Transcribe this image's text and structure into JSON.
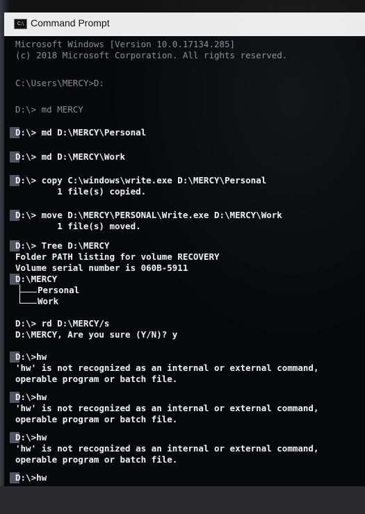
{
  "window": {
    "title": "Command Prompt",
    "icon": "C:\\",
    "background": "#070809",
    "text_color": "#f2f2f2"
  },
  "console": {
    "lines": [
      "Microsoft Windows [Version 10.0.17134.285]",
      "(c) 2018 Microsoft Corporation. All rights reserved.",
      "C:\\Users\\MERCY>D:",
      "D:\\> md MERCY",
      "D:\\> md D:\\MERCY\\Personal",
      "D:\\> md D:\\MERCY\\Work",
      "D:\\> copy C:\\windows\\write.exe D:\\MERCY\\Personal",
      "        1 file(s) copied.",
      "D:\\> move D:\\MERCY\\PERSONAL\\Write.exe D:\\MERCY\\Work",
      "        1 file(s) moved.",
      "D:\\> Tree D:\\MERCY",
      "Folder PATH listing for volume RECOVERY",
      "Volume serial number is 060B-5911",
      "D:\\MERCY",
      "Personal",
      "Work",
      "D:\\> rd D:\\MERCY/s",
      "D:\\MERCY, Are you sure (Y/N)? y",
      "D:\\>hw",
      "'hw' is not recognized as an internal or external command,",
      "operable program or batch file.",
      "D:\\>hw",
      "'hw' is not recognized as an internal or external command,",
      "operable program or batch file.",
      "D:\\>hw",
      "'hw' is not recognized as an internal or external command,",
      "operable program or batch file.",
      "D:\\>hw"
    ]
  }
}
